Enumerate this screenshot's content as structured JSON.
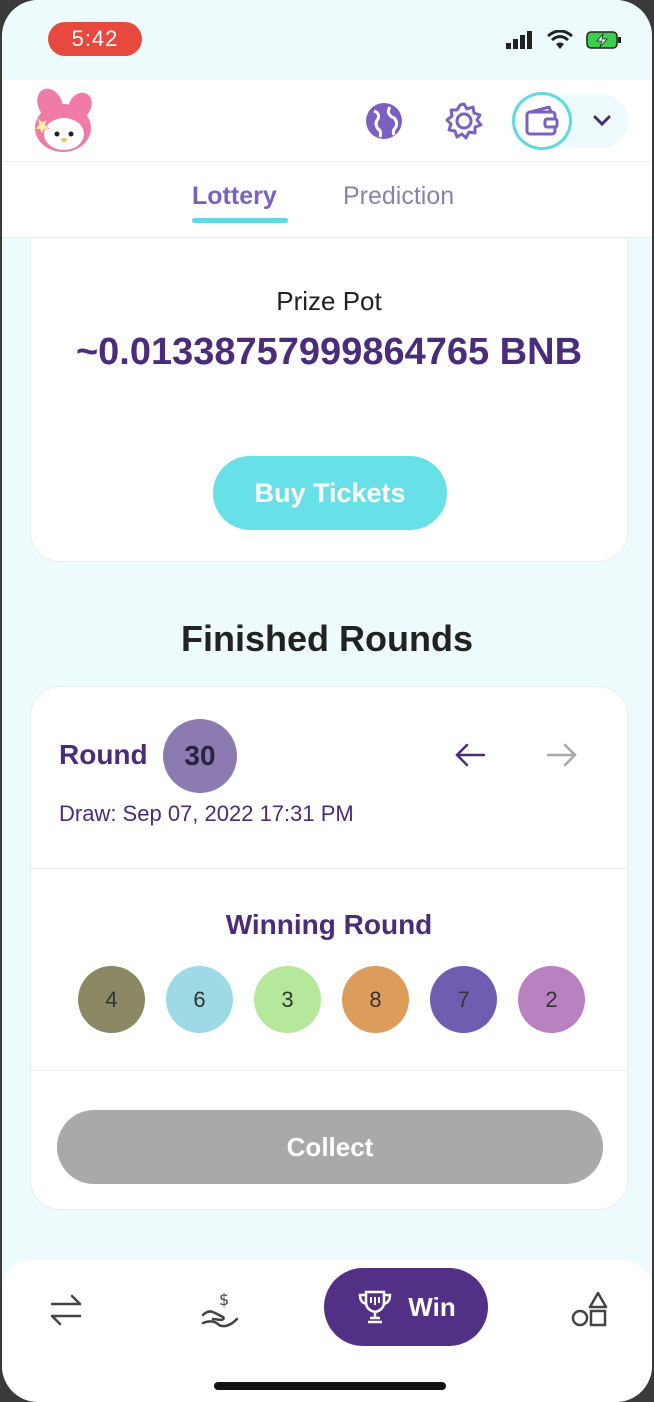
{
  "status_bar": {
    "time": "5:42",
    "icons": [
      "signal-icon",
      "wifi-icon",
      "battery-charging-icon"
    ]
  },
  "header": {
    "logo": "my-melody-logo",
    "icons": [
      "globe-icon",
      "gear-icon",
      "wallet-icon",
      "chevron-down-icon"
    ]
  },
  "tabs": [
    {
      "label": "Lottery",
      "active": true
    },
    {
      "label": "Prediction",
      "active": false
    }
  ],
  "prize": {
    "label": "Prize Pot",
    "value": "~0.01338757999864765 BNB",
    "buy_button": "Buy Tickets"
  },
  "finished": {
    "title": "Finished Rounds",
    "round_label": "Round",
    "round_number": "30",
    "draw_text": "Draw: Sep 07, 2022 17:31 PM",
    "winning_title": "Winning Round",
    "balls": [
      {
        "value": "4",
        "color": "#8b8863"
      },
      {
        "value": "6",
        "color": "#9edae6"
      },
      {
        "value": "3",
        "color": "#b5e89a"
      },
      {
        "value": "8",
        "color": "#de9c5c"
      },
      {
        "value": "7",
        "color": "#6e5db0"
      },
      {
        "value": "2",
        "color": "#b981bf"
      }
    ],
    "collect_button": "Collect"
  },
  "bottom_nav": {
    "items": [
      "swap-icon",
      "earn-icon",
      "trophy-icon",
      "shapes-icon"
    ],
    "win_label": "Win"
  },
  "colors": {
    "accent": "#5ed9e1",
    "primary": "#523086",
    "text_purple": "#4a2c7a"
  }
}
